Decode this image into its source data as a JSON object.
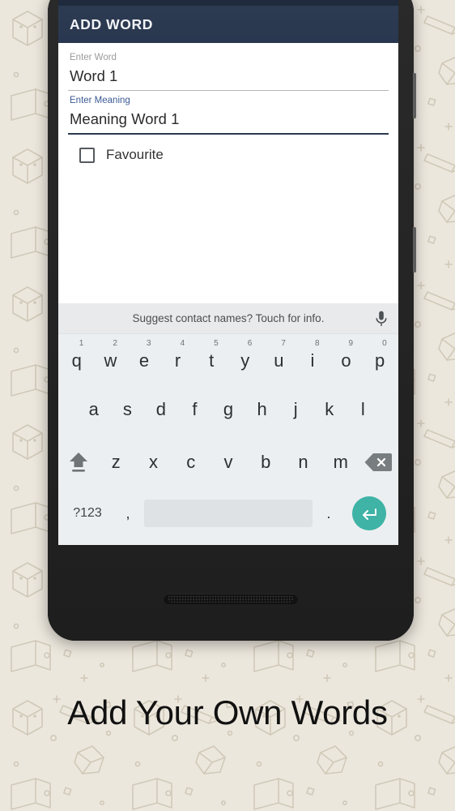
{
  "caption": "Add Your Own Words",
  "app": {
    "bar_title": "ADD WORD"
  },
  "form": {
    "word_field": {
      "label": "Enter Word",
      "value": "Word 1",
      "focused": false
    },
    "meaning_field": {
      "label": "Enter Meaning",
      "value": "Meaning Word 1",
      "focused": true
    },
    "favourite": {
      "label": "Favourite",
      "checked": false
    }
  },
  "fab": {
    "icon": "plus-icon",
    "label": "+"
  },
  "keyboard": {
    "suggestion_text": "Suggest contact names? Touch for info.",
    "mic_icon": "microphone-icon",
    "row1": [
      {
        "key": "q",
        "sup": "1"
      },
      {
        "key": "w",
        "sup": "2"
      },
      {
        "key": "e",
        "sup": "3"
      },
      {
        "key": "r",
        "sup": "4"
      },
      {
        "key": "t",
        "sup": "5"
      },
      {
        "key": "y",
        "sup": "6"
      },
      {
        "key": "u",
        "sup": "7"
      },
      {
        "key": "i",
        "sup": "8"
      },
      {
        "key": "o",
        "sup": "9"
      },
      {
        "key": "p",
        "sup": "0"
      }
    ],
    "row2": [
      "a",
      "s",
      "d",
      "f",
      "g",
      "h",
      "j",
      "k",
      "l"
    ],
    "row3": {
      "shift_icon": "shift-icon",
      "letters": [
        "z",
        "x",
        "c",
        "v",
        "b",
        "n",
        "m"
      ],
      "backspace_icon": "backspace-icon"
    },
    "row4": {
      "symbols_label": "?123",
      "comma_label": ",",
      "space_label": "",
      "period_label": ".",
      "enter_icon": "enter-icon"
    }
  },
  "colors": {
    "app_bar": "#2b3950",
    "accent_blue": "#3c5a96",
    "enter_key": "#3fb3a6",
    "ripple": "#8ab4f2",
    "background": "#ece7dd"
  }
}
